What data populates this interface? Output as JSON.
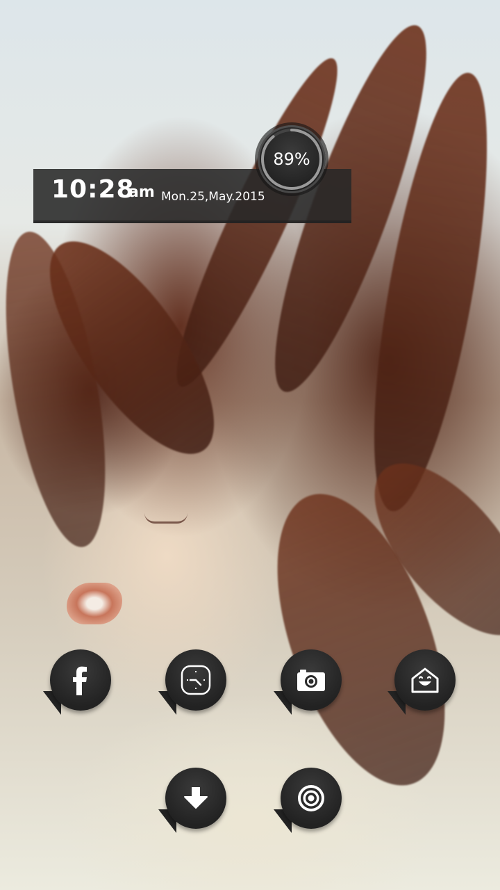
{
  "widget": {
    "time": "10:28",
    "ampm": "am",
    "date": "Mon.25,May.2015",
    "battery": "89%",
    "battery_level": 0.89
  },
  "icons": [
    {
      "name": "facebook-icon"
    },
    {
      "name": "clock-app-icon"
    },
    {
      "name": "camera-icon"
    },
    {
      "name": "home-smile-icon"
    },
    {
      "name": "download-icon"
    },
    {
      "name": "music-disc-icon"
    }
  ],
  "colors": {
    "widget_bg": "#282828",
    "icon_bg": "#2a2a2a",
    "icon_fg": "#ffffff"
  }
}
